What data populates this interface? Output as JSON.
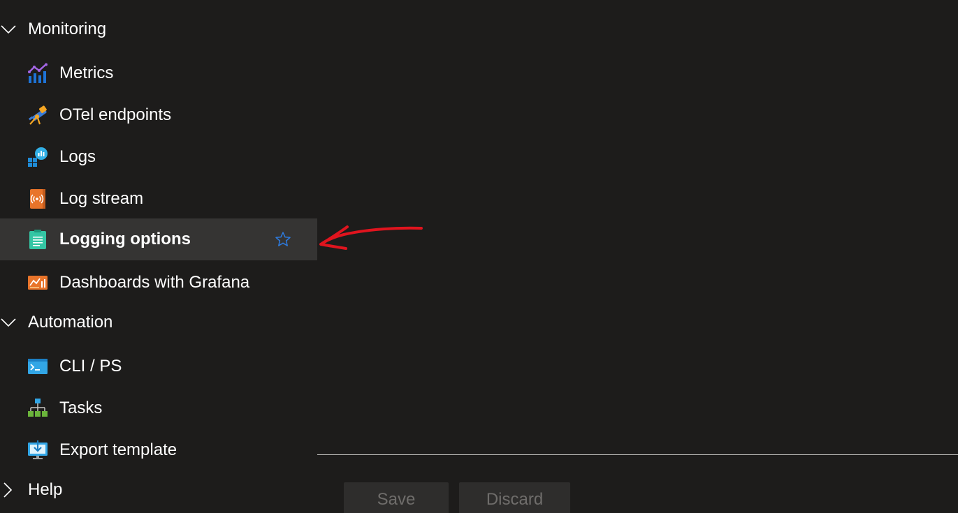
{
  "sidebar": {
    "groups": [
      {
        "label": "Monitoring",
        "expanded": true,
        "items": [
          {
            "label": "Metrics",
            "icon": "metrics-icon"
          },
          {
            "label": "OTel endpoints",
            "icon": "telescope-icon"
          },
          {
            "label": "Logs",
            "icon": "logs-icon"
          },
          {
            "label": "Log stream",
            "icon": "log-stream-icon"
          },
          {
            "label": "Logging options",
            "icon": "logging-options-icon",
            "selected": true
          },
          {
            "label": "Dashboards with Grafana",
            "icon": "grafana-dashboard-icon"
          }
        ]
      },
      {
        "label": "Automation",
        "expanded": true,
        "items": [
          {
            "label": "CLI / PS",
            "icon": "terminal-icon"
          },
          {
            "label": "Tasks",
            "icon": "tasks-icon"
          },
          {
            "label": "Export template",
            "icon": "export-template-icon"
          }
        ]
      },
      {
        "label": "Help",
        "expanded": false,
        "items": []
      }
    ]
  },
  "footer": {
    "save_label": "Save",
    "discard_label": "Discard"
  },
  "colors": {
    "background": "#1d1c1b",
    "selected_row": "#353433",
    "star": "#2d7be0",
    "annotation_arrow": "#e0141e",
    "disabled_button_bg": "#2e2d2c",
    "disabled_button_text": "#6f6d6b"
  }
}
